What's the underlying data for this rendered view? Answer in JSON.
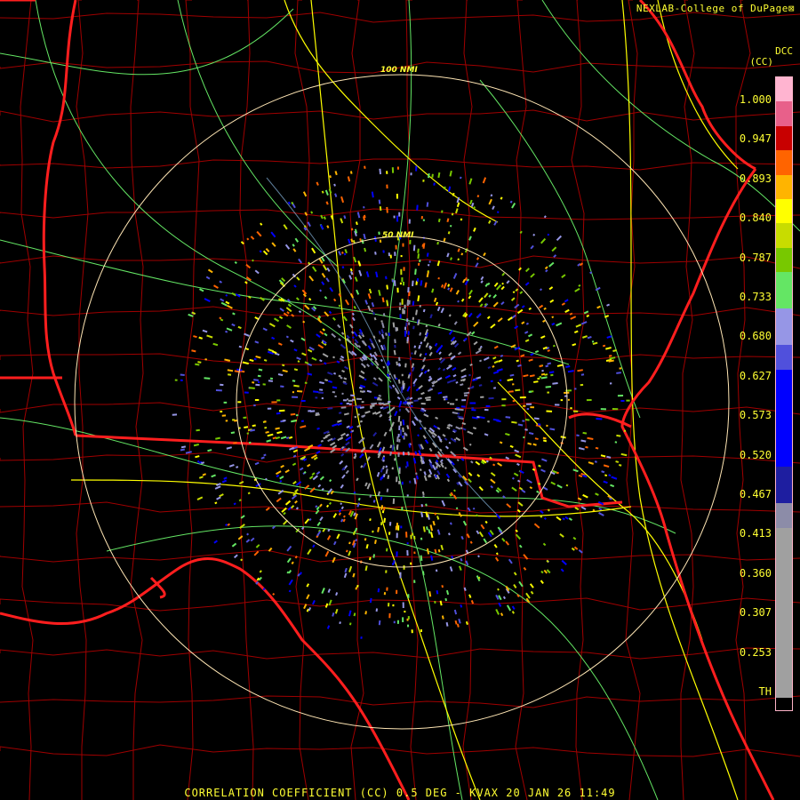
{
  "header": {
    "credit": "NEXLAB-College of DuPage"
  },
  "legend": {
    "unit_short": "DCC",
    "unit_paren": "(CC)",
    "ticks": [
      "1.000",
      "0.947",
      "0.893",
      "0.840",
      "0.787",
      "0.733",
      "0.680",
      "0.627",
      "0.573",
      "0.520",
      "0.467",
      "0.413",
      "0.360",
      "0.307",
      "0.253",
      "TH"
    ],
    "bands": [
      {
        "color": "#ffb4d0",
        "n": 2
      },
      {
        "color": "#e8608a",
        "n": 2
      },
      {
        "color": "#c80000",
        "n": 2
      },
      {
        "color": "#ff6400",
        "n": 2
      },
      {
        "color": "#ffb400",
        "n": 2
      },
      {
        "color": "#ffff00",
        "n": 2
      },
      {
        "color": "#c8dc00",
        "n": 2
      },
      {
        "color": "#78c800",
        "n": 2
      },
      {
        "color": "#64e664",
        "n": 3
      },
      {
        "color": "#9696e6",
        "n": 3
      },
      {
        "color": "#5050dc",
        "n": 2
      },
      {
        "color": "#0000ff",
        "n": 8
      },
      {
        "color": "#1e1ea0",
        "n": 3
      },
      {
        "color": "#8c8ca8",
        "n": 2
      },
      {
        "color": "#a0a0a0",
        "n": 14
      },
      {
        "color": "#000000",
        "n": 1
      }
    ]
  },
  "range_rings": [
    {
      "label": "100 NMI"
    },
    {
      "label": "50 NMI"
    }
  ],
  "footer": {
    "product": "CORRELATION COEFFICIENT (CC) 0.5 DEG - KVAX 20 JAN 26 11:49"
  },
  "colors": {
    "state_lines": "#ff1e1e",
    "county_lines": "#b40000",
    "highways": "#ffff00",
    "roads": "#64e664",
    "rings": "#ffe6b4",
    "text": "#ffff33"
  }
}
